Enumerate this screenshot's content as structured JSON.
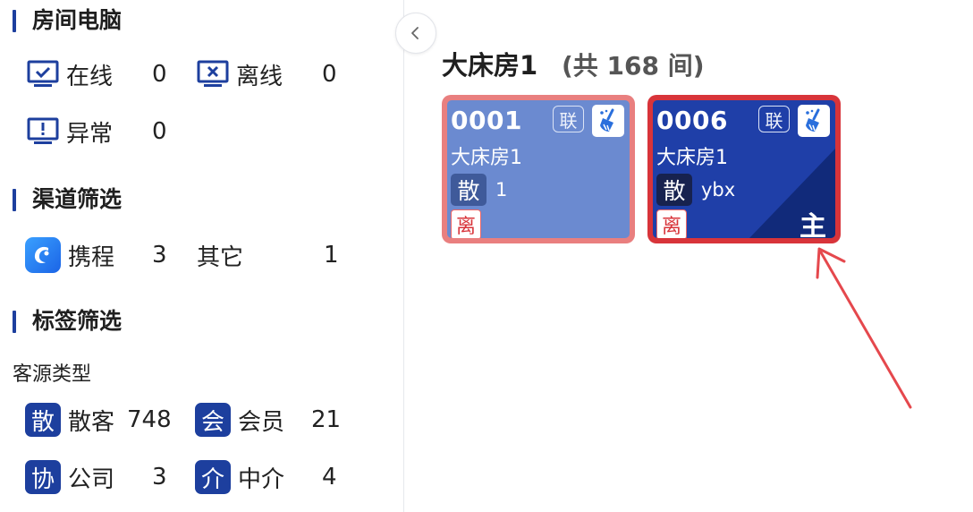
{
  "sidebar": {
    "room_pc": {
      "title": "房间电脑",
      "online_label": "在线",
      "online_count": "0",
      "offline_label": "离线",
      "offline_count": "0",
      "abnormal_label": "异常",
      "abnormal_count": "0"
    },
    "channel": {
      "title": "渠道筛选",
      "ctrip_label": "携程",
      "ctrip_count": "3",
      "other_label": "其它",
      "other_count": "1"
    },
    "tags": {
      "title": "标签筛选",
      "guest_type_label": "客源类型",
      "items": [
        {
          "badge": "散",
          "label": "散客",
          "count": "748"
        },
        {
          "badge": "会",
          "label": "会员",
          "count": "21"
        },
        {
          "badge": "协",
          "label": "公司",
          "count": "3"
        },
        {
          "badge": "介",
          "label": "中介",
          "count": "4"
        }
      ]
    }
  },
  "main": {
    "room_type": "大床房1",
    "room_count": "(共 168 间)",
    "cards": [
      {
        "number": "0001",
        "type": "大床房1",
        "lian": "联",
        "san": "散",
        "guest": "1",
        "li": "离",
        "zhu": ""
      },
      {
        "number": "0006",
        "type": "大床房1",
        "lian": "联",
        "san": "散",
        "guest": "ybx",
        "li": "离",
        "zhu": "主"
      }
    ]
  },
  "colors": {
    "brand_blue": "#1d3f9e",
    "card_border_light": "#e97f7f",
    "card_border_dark": "#d8343a",
    "arrow_red": "#e5484d"
  },
  "icons": {
    "collapse": "chevron-left-icon",
    "online": "monitor-check-icon",
    "offline": "monitor-x-icon",
    "abnormal": "monitor-alert-icon",
    "ctrip": "ctrip-dolphin-icon",
    "clean": "broom-icon"
  }
}
